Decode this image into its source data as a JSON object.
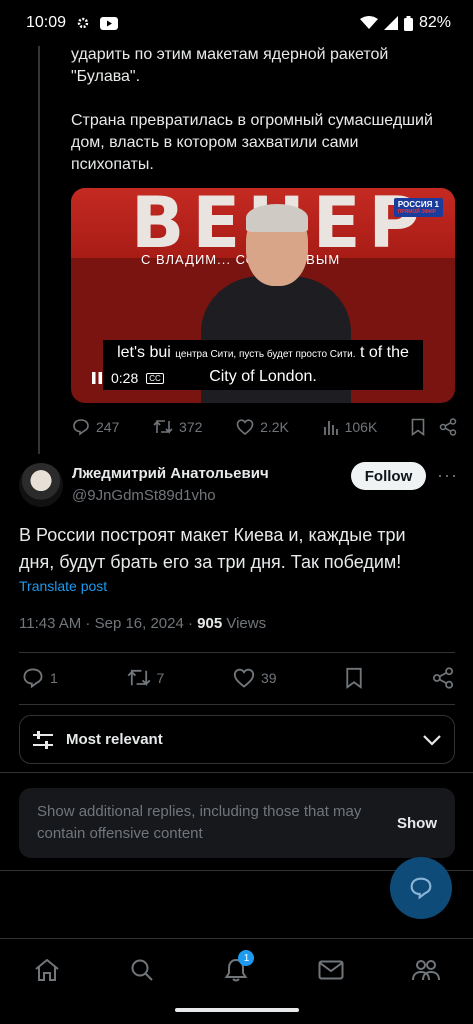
{
  "status_bar": {
    "time": "10:09",
    "battery": "82%"
  },
  "quoted_post": {
    "text_line_1": "ударить по этим макетам ядерной ракетой",
    "text_line_2": "\"Булава\".",
    "text_para_2_line_1": "Страна превратилась в огромный сумасшедший",
    "text_para_2_line_2": "дом, власть в котором захватили сами",
    "text_para_2_line_3": "психопаты.",
    "video": {
      "banner_word": "ВЕЧЕР",
      "banner_sub": "С ВЛАДИМ... СОЛОВЬЕВЫМ",
      "channel_logo": "РОССИЯ 1",
      "channel_logo_sub": "ПРЯМОЙ ЭФИР",
      "subtitle_en_1": "let's bui",
      "subtitle_ru": "центра Сити, пусть будет просто Сити.",
      "subtitle_en_1b": "t of the",
      "subtitle_en_2": "City of London.",
      "time": "0:28",
      "cc": "CC"
    },
    "replies": "247",
    "reposts": "372",
    "likes": "2.2K",
    "views": "106K"
  },
  "main_post": {
    "author_name": "Лжедмитрий Анатольевич",
    "author_handle": "@9JnGdmSt89d1vho",
    "follow_label": "Follow",
    "more": "···",
    "text_line_1": "В России построят макет Киева и, каждые три",
    "text_line_2": "дня, будут брать его за три дня. Так победим!",
    "translate_label": "Translate post",
    "timestamp": "11:43 AM · Sep 16, 2024 · ",
    "views_count": "905",
    "views_label": " Views",
    "replies": "1",
    "reposts": "7",
    "likes": "39"
  },
  "sort": {
    "label": "Most relevant"
  },
  "hidden_replies": {
    "text": "Show additional replies, including those that may contain offensive content",
    "show_label": "Show"
  },
  "tabbar": {
    "notifications_badge": "1"
  },
  "colors": {
    "accent": "#1d9bf0",
    "muted": "#71767b",
    "text": "#e7e9ea",
    "background": "#000000"
  }
}
